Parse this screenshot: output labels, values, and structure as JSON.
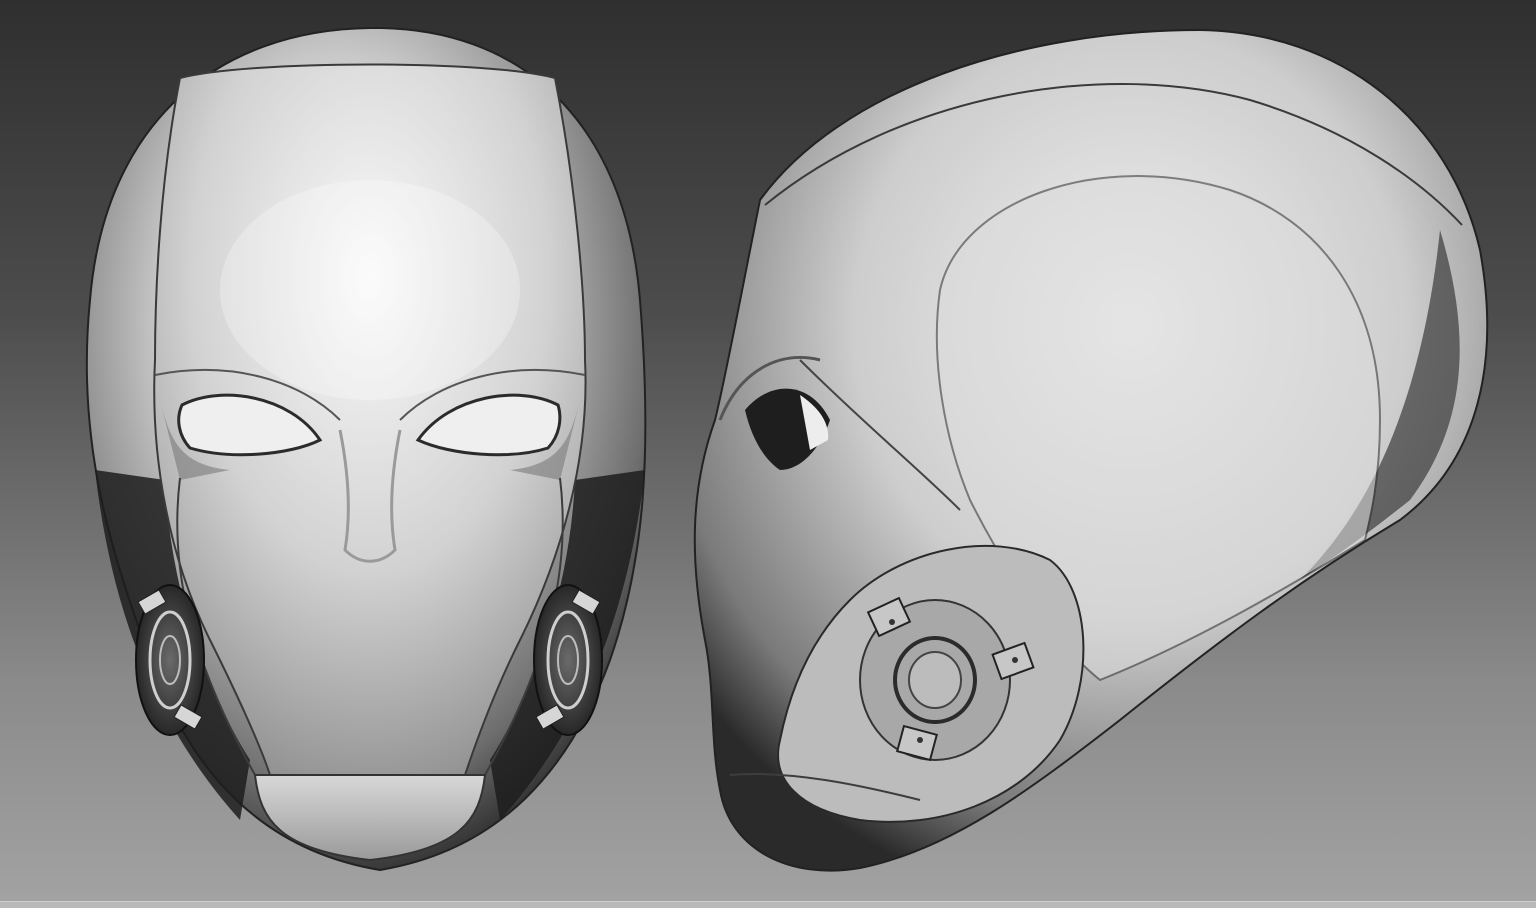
{
  "scene": {
    "background_top": "#2f2f2f",
    "background_bottom": "#a3a3a3",
    "material_color": "#c8c8c8",
    "views": [
      {
        "id": "front-view",
        "subject": "helmet-mask-front"
      },
      {
        "id": "side-view",
        "subject": "helmet-mask-side"
      }
    ]
  }
}
